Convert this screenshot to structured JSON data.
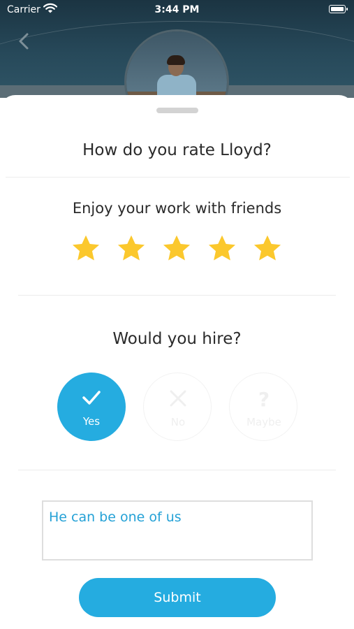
{
  "status_bar": {
    "carrier": "Carrier",
    "time": "3:44 PM"
  },
  "colors": {
    "accent": "#25ace0",
    "star": "#fbc82d",
    "header": "#27495a"
  },
  "sheet": {
    "title": "How do you rate Lloyd?",
    "rating": {
      "label": "Enjoy your work with friends",
      "value": 5,
      "max": 5
    },
    "hire": {
      "question": "Would you hire?",
      "options": [
        {
          "label": "Yes",
          "icon": "check-icon",
          "selected": true
        },
        {
          "label": "No",
          "icon": "close-icon",
          "selected": false
        },
        {
          "label": "Maybe",
          "icon": "question-icon",
          "selected": false
        }
      ]
    },
    "comment": {
      "value": "He can be one of us"
    },
    "submit_label": "Submit"
  }
}
